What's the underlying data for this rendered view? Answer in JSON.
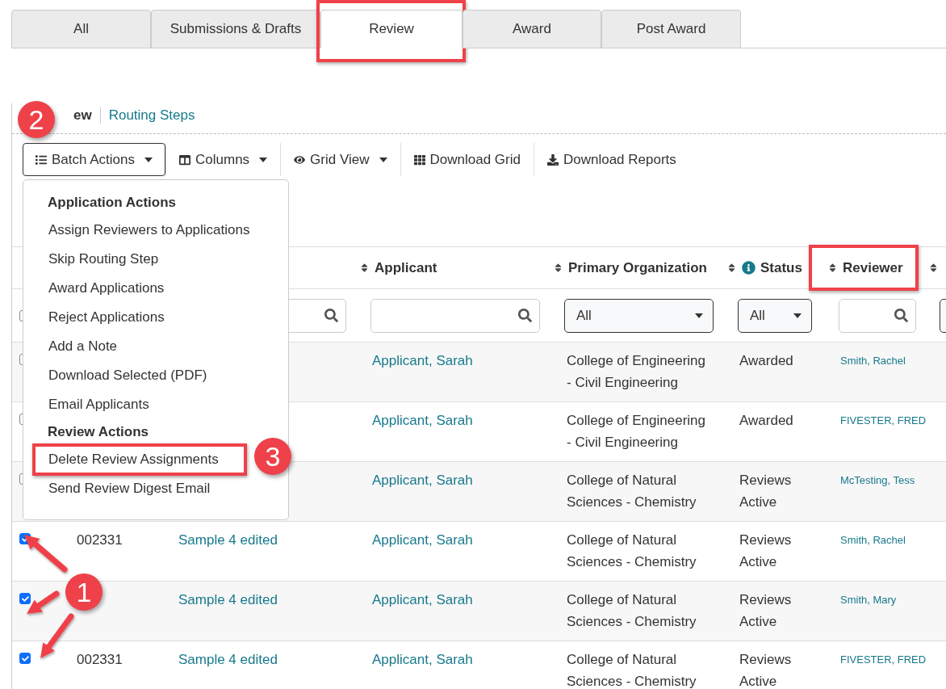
{
  "tabs": [
    {
      "label": "All",
      "selected": false,
      "highlighted": false
    },
    {
      "label": "Submissions & Drafts",
      "selected": false,
      "highlighted": false
    },
    {
      "label": "Review",
      "selected": true,
      "highlighted": true
    },
    {
      "label": "Award",
      "selected": false,
      "highlighted": false
    },
    {
      "label": "Post Award",
      "selected": false,
      "highlighted": false
    }
  ],
  "subnav": [
    {
      "label": "ew",
      "selected": true
    },
    {
      "label": "Routing Steps",
      "selected": false
    }
  ],
  "toolbar": [
    {
      "label": "Batch Actions",
      "kind": "dropdown",
      "open": true
    },
    {
      "label": "Columns",
      "kind": "dropdown",
      "open": false
    },
    {
      "label": "Grid View",
      "kind": "dropdown",
      "open": false
    },
    {
      "label": "Download Grid",
      "kind": "button"
    },
    {
      "label": "Download Reports",
      "kind": "button"
    }
  ],
  "batch_menu": {
    "sections": [
      {
        "heading": "Application Actions",
        "items": [
          {
            "label": "Assign Reviewers to Applications",
            "highlighted": false
          },
          {
            "label": "Skip Routing Step",
            "highlighted": false
          },
          {
            "label": "Award Applications",
            "highlighted": false
          },
          {
            "label": "Reject Applications",
            "highlighted": false
          },
          {
            "label": "Add a Note",
            "highlighted": false
          },
          {
            "label": "Download Selected (PDF)",
            "highlighted": false
          },
          {
            "label": "Email Applicants",
            "highlighted": false
          }
        ]
      },
      {
        "heading": "Review Actions",
        "items": [
          {
            "label": "Delete Review Assignments",
            "highlighted": true
          },
          {
            "label": "Send Review Digest Email",
            "highlighted": false
          }
        ]
      }
    ]
  },
  "table": {
    "columns": [
      {
        "label": "Applicant",
        "sortable": true,
        "info": false,
        "highlighted": false
      },
      {
        "label": "Primary Organization",
        "sortable": true,
        "info": false,
        "highlighted": false
      },
      {
        "label": "Status",
        "sortable": true,
        "info": true,
        "highlighted": false
      },
      {
        "label": "Reviewer",
        "sortable": true,
        "info": false,
        "highlighted": true
      },
      {
        "sortable": true,
        "info": false,
        "highlighted": false
      }
    ],
    "filters": [
      {
        "kind": "checkbox",
        "checked": false
      },
      {
        "kind": "blank"
      },
      {
        "kind": "search"
      },
      {
        "kind": "search"
      },
      {
        "kind": "select",
        "value": "All"
      },
      {
        "kind": "select",
        "value": "All"
      },
      {
        "kind": "search"
      },
      {
        "kind": "select"
      }
    ],
    "rows": [
      {
        "checked": false,
        "applicant": "Applicant, Sarah",
        "organization": [
          "College of Engineering",
          "- Civil Engineering"
        ],
        "status": [
          "Awarded"
        ],
        "reviewer": "Smith, Rachel"
      },
      {
        "checked": false,
        "applicant": "Applicant, Sarah",
        "organization": [
          "College of Engineering",
          "- Civil Engineering"
        ],
        "status": [
          "Awarded"
        ],
        "reviewer": "FIVESTER, FRED"
      },
      {
        "checked": false,
        "applicant": "Applicant, Sarah",
        "organization": [
          "College of Natural",
          "Sciences - Chemistry"
        ],
        "status": [
          "Reviews",
          "Active"
        ],
        "reviewer": "McTesting, Tess"
      },
      {
        "checked": true,
        "id": "002331",
        "title": "Sample 4 edited",
        "applicant": "Applicant, Sarah",
        "organization": [
          "College of Natural",
          "Sciences - Chemistry"
        ],
        "status": [
          "Reviews",
          "Active"
        ],
        "reviewer": "Smith, Rachel"
      },
      {
        "checked": true,
        "title": "Sample 4 edited",
        "applicant": "Applicant, Sarah",
        "organization": [
          "College of Natural",
          "Sciences - Chemistry"
        ],
        "status": [
          "Reviews",
          "Active"
        ],
        "reviewer": "Smith, Mary"
      },
      {
        "checked": true,
        "id": "002331",
        "title": "Sample 4 edited",
        "applicant": "Applicant, Sarah",
        "organization": [
          "College of Natural",
          "Sciences - Chemistry"
        ],
        "status": [
          "Reviews",
          "Active"
        ],
        "reviewer": "FIVESTER, FRED"
      }
    ]
  },
  "callouts": [
    {
      "label": "2"
    },
    {
      "label": "3"
    },
    {
      "label": "1"
    }
  ]
}
